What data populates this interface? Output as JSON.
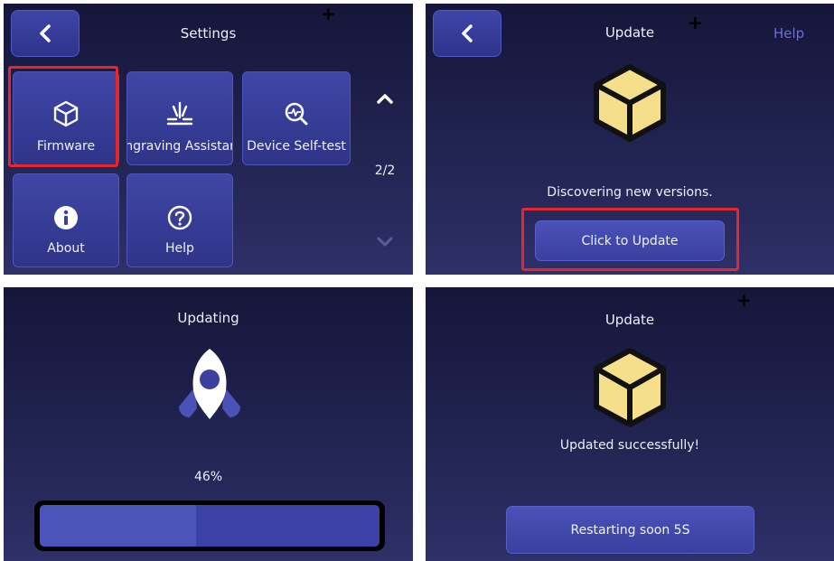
{
  "settings": {
    "title": "Settings",
    "tiles": [
      {
        "label": "Firmware",
        "icon": "cube-outline-icon"
      },
      {
        "label": "Engraving Assistant",
        "icon": "laser-beam-icon"
      },
      {
        "label": "Device Self-test",
        "icon": "diagnostic-search-icon"
      },
      {
        "label": "About",
        "icon": "info-circle-icon"
      },
      {
        "label": "Help",
        "icon": "question-circle-icon"
      }
    ],
    "page_indicator": "2/2"
  },
  "update": {
    "title": "Update",
    "help_link": "Help",
    "status": "Discovering new versions.",
    "button_label": "Click to Update"
  },
  "updating": {
    "title": "Updating",
    "percent_text": "46%",
    "progress": 0.46
  },
  "done": {
    "title": "Update",
    "status": "Updated successfully!",
    "button_label": "Restarting soon 5S"
  },
  "colors": {
    "accent": "#3f46a6",
    "highlight": "#e4262e",
    "box_yellow": "#f6df8a"
  }
}
